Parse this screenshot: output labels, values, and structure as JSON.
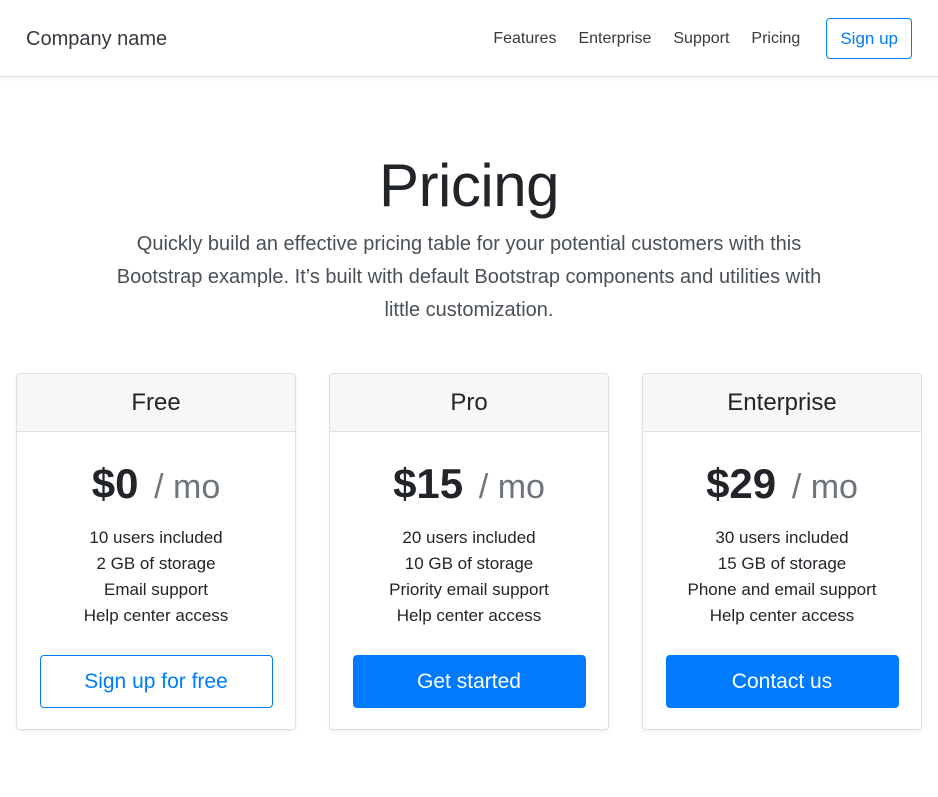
{
  "navbar": {
    "brand": "Company name",
    "links": [
      "Features",
      "Enterprise",
      "Support",
      "Pricing"
    ],
    "signup_label": "Sign up"
  },
  "hero": {
    "title": "Pricing",
    "lead": "Quickly build an effective pricing table for your potential customers with this Bootstrap example. It’s built with default Bootstrap components and utilities with little customization."
  },
  "plans": [
    {
      "name": "Free",
      "price": "$0",
      "period": "/ mo",
      "features": [
        "10 users included",
        "2 GB of storage",
        "Email support",
        "Help center access"
      ],
      "button_label": "Sign up for free",
      "button_style": "outline"
    },
    {
      "name": "Pro",
      "price": "$15",
      "period": "/ mo",
      "features": [
        "20 users included",
        "10 GB of storage",
        "Priority email support",
        "Help center access"
      ],
      "button_label": "Get started",
      "button_style": "primary"
    },
    {
      "name": "Enterprise",
      "price": "$29",
      "period": "/ mo",
      "features": [
        "30 users included",
        "15 GB of storage",
        "Phone and email support",
        "Help center access"
      ],
      "button_label": "Contact us",
      "button_style": "primary"
    }
  ],
  "colors": {
    "primary": "#007bff",
    "text": "#212529",
    "muted": "#6c757d",
    "card_header_bg": "#f7f7f7",
    "border": "#dfdfdf"
  }
}
